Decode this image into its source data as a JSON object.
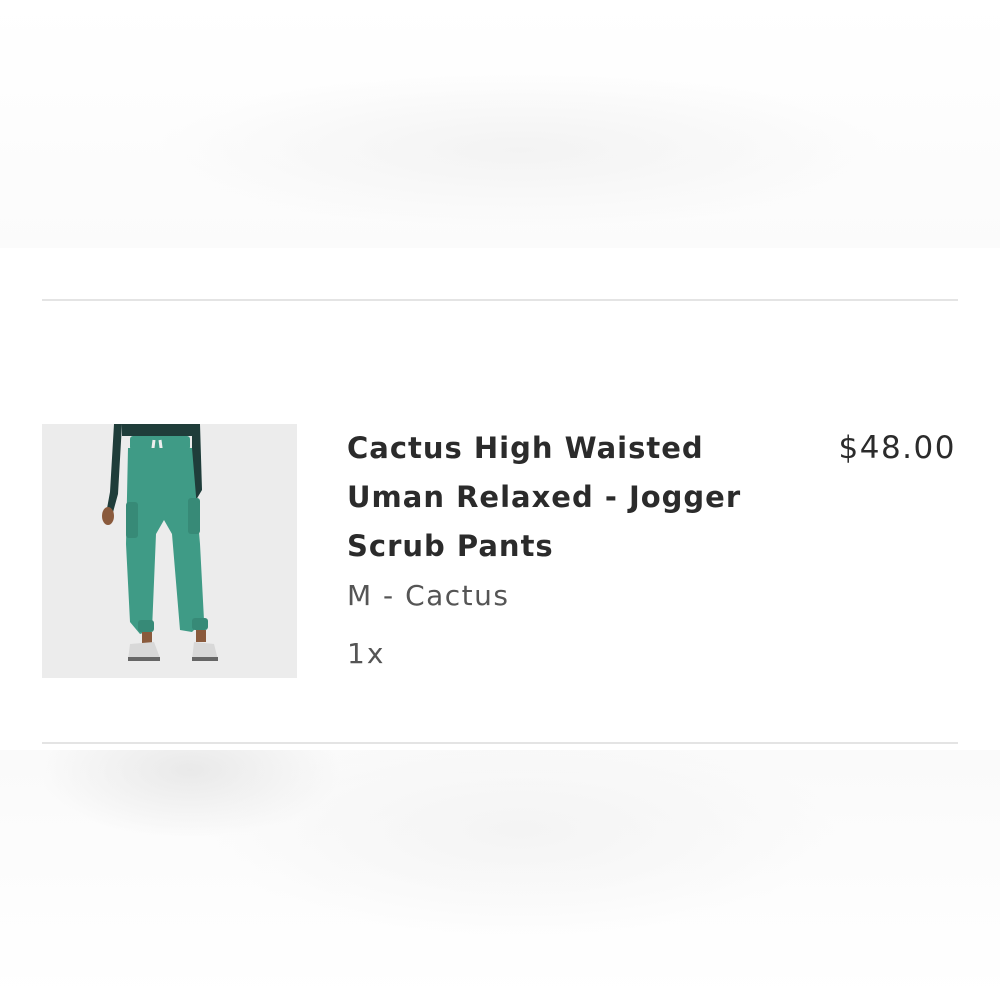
{
  "cart_item": {
    "title": "Cactus High Waisted\nUman Relaxed - Jogger\nScrub Pants",
    "price": "$48.00",
    "variant": "M - Cactus",
    "quantity": "1x",
    "image_icon": "product-photo-jogger-scrub-pants"
  },
  "colors": {
    "pants": "#3f9b86",
    "top": "#1f3d3a",
    "divider": "#e4e4e4",
    "text_primary": "#2b2b2b",
    "text_secondary": "#555555"
  }
}
